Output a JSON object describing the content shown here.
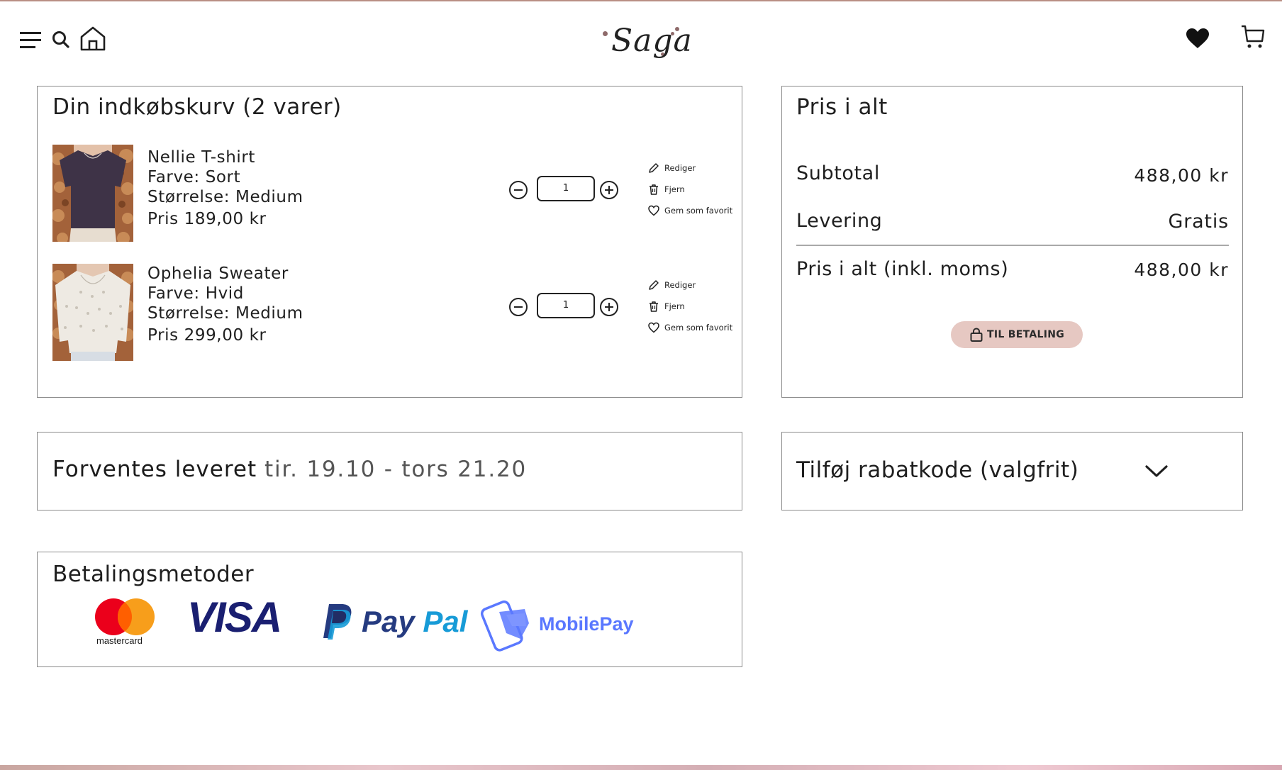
{
  "header": {
    "menu_icon": "hamburger-menu-icon",
    "search_icon": "search-icon",
    "home_icon": "home-icon",
    "logo_text": "Saga",
    "favorites_icon": "heart-icon",
    "cart_icon": "cart-icon"
  },
  "cart": {
    "title": "Din indkøbskurv (2 varer)",
    "items": [
      {
        "name": "Nellie T-shirt",
        "color": "Farve: Sort",
        "size": "Størrelse: Medium",
        "price": "Pris 189,00 kr",
        "quantity": "1",
        "edit_label": "Rediger",
        "remove_label": "Fjern",
        "favorite_label": "Gem som favorit"
      },
      {
        "name": "Ophelia Sweater",
        "color": "Farve: Hvid",
        "size": "Størrelse: Medium",
        "price": "Pris 299,00 kr",
        "quantity": "1",
        "edit_label": "Rediger",
        "remove_label": "Fjern",
        "favorite_label": "Gem som favorit"
      }
    ]
  },
  "summary": {
    "title": "Pris i alt",
    "subtotal_label": "Subtotal",
    "subtotal_value": "488,00 kr",
    "delivery_label": "Levering",
    "delivery_value": "Gratis",
    "total_label": "Pris i alt (inkl. moms)",
    "total_value": "488,00 kr",
    "checkout_button": "TIL BETALING"
  },
  "delivery": {
    "label": "Forventes leveret",
    "dates": "tir. 19.10 - tors 21.20"
  },
  "discount": {
    "label": "Tilføj rabatkode (valgfrit)"
  },
  "payment": {
    "title": "Betalingsmetoder",
    "methods": [
      "mastercard",
      "VISA",
      "PayPal",
      "MobilePay"
    ]
  },
  "colors": {
    "accent_button": "#e6c8c2",
    "logo_dot": "#8e6a6a",
    "border": "#8c8c8c"
  }
}
